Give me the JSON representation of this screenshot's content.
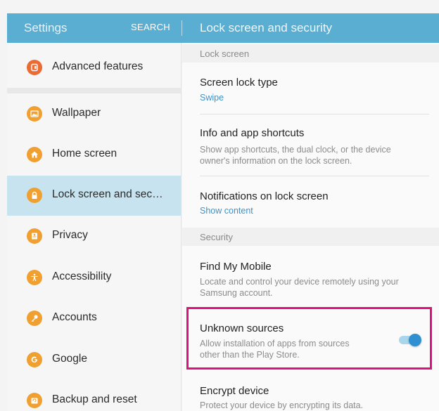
{
  "header": {
    "title": "Settings",
    "search_label": "SEARCH",
    "page_title": "Lock screen and security"
  },
  "sidebar": {
    "items": [
      {
        "label": "Advanced features",
        "icon": "advanced-features-icon"
      },
      {
        "label": "Wallpaper",
        "icon": "wallpaper-icon"
      },
      {
        "label": "Home screen",
        "icon": "home-icon"
      },
      {
        "label": "Lock screen and sec…",
        "icon": "lock-icon",
        "selected": true
      },
      {
        "label": "Privacy",
        "icon": "privacy-icon"
      },
      {
        "label": "Accessibility",
        "icon": "accessibility-icon"
      },
      {
        "label": "Accounts",
        "icon": "key-icon"
      },
      {
        "label": "Google",
        "icon": "google-icon"
      },
      {
        "label": "Backup and reset",
        "icon": "backup-icon"
      }
    ]
  },
  "content": {
    "section_lock": "Lock screen",
    "screen_lock": {
      "title": "Screen lock type",
      "value": "Swipe"
    },
    "info_shortcuts": {
      "title": "Info and app shortcuts",
      "desc_line1": "Show app shortcuts, the dual clock, or the device",
      "desc_line2": "owner's information on the lock screen."
    },
    "notifications": {
      "title": "Notifications on lock screen",
      "value": "Show content"
    },
    "section_security": "Security",
    "find_my_mobile": {
      "title": "Find My Mobile",
      "desc_line1": "Locate and control your device remotely using your",
      "desc_line2": "Samsung account."
    },
    "unknown_sources": {
      "title": "Unknown sources",
      "desc_line1": "Allow installation of apps from sources",
      "desc_line2": "other than the Play Store.",
      "enabled": true
    },
    "encrypt": {
      "title": "Encrypt device",
      "desc": "Protect your device by encrypting its data."
    }
  },
  "colors": {
    "header": "#5aaed1",
    "selected_item": "#c6e3ef",
    "icon_orange": "#f0a030",
    "icon_red": "#ea6c34",
    "accent_text": "#3c93c7",
    "toggle_on": "#2f8fd0",
    "highlight_box": "#e0107e"
  }
}
